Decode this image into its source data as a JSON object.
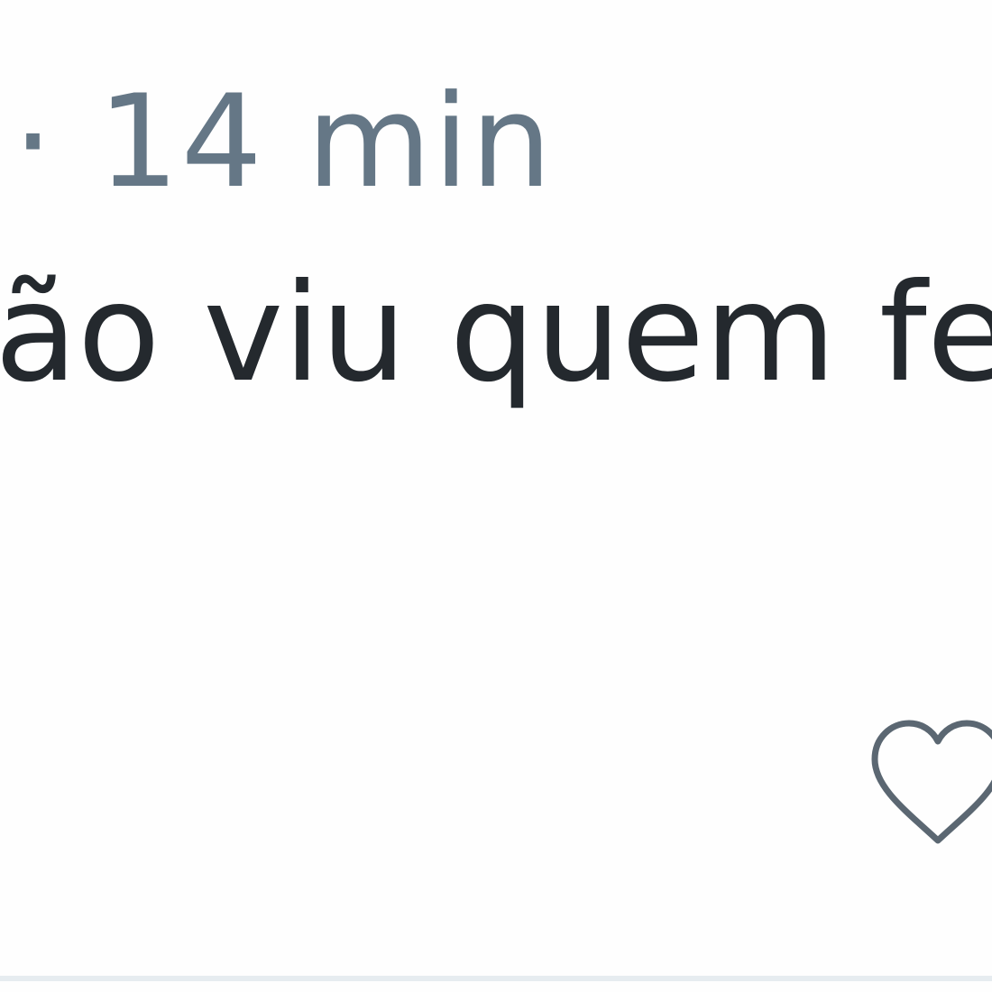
{
  "post": {
    "separator": "·",
    "timestamp": "14 min",
    "text": "ão viu quem fecho"
  },
  "actions": {
    "like_icon": "heart-outline-icon"
  },
  "colors": {
    "meta_text": "#657786",
    "body_text": "#24292e",
    "icon_stroke": "#5b6772",
    "divider": "#e6ecf0",
    "background": "#fefefe"
  }
}
